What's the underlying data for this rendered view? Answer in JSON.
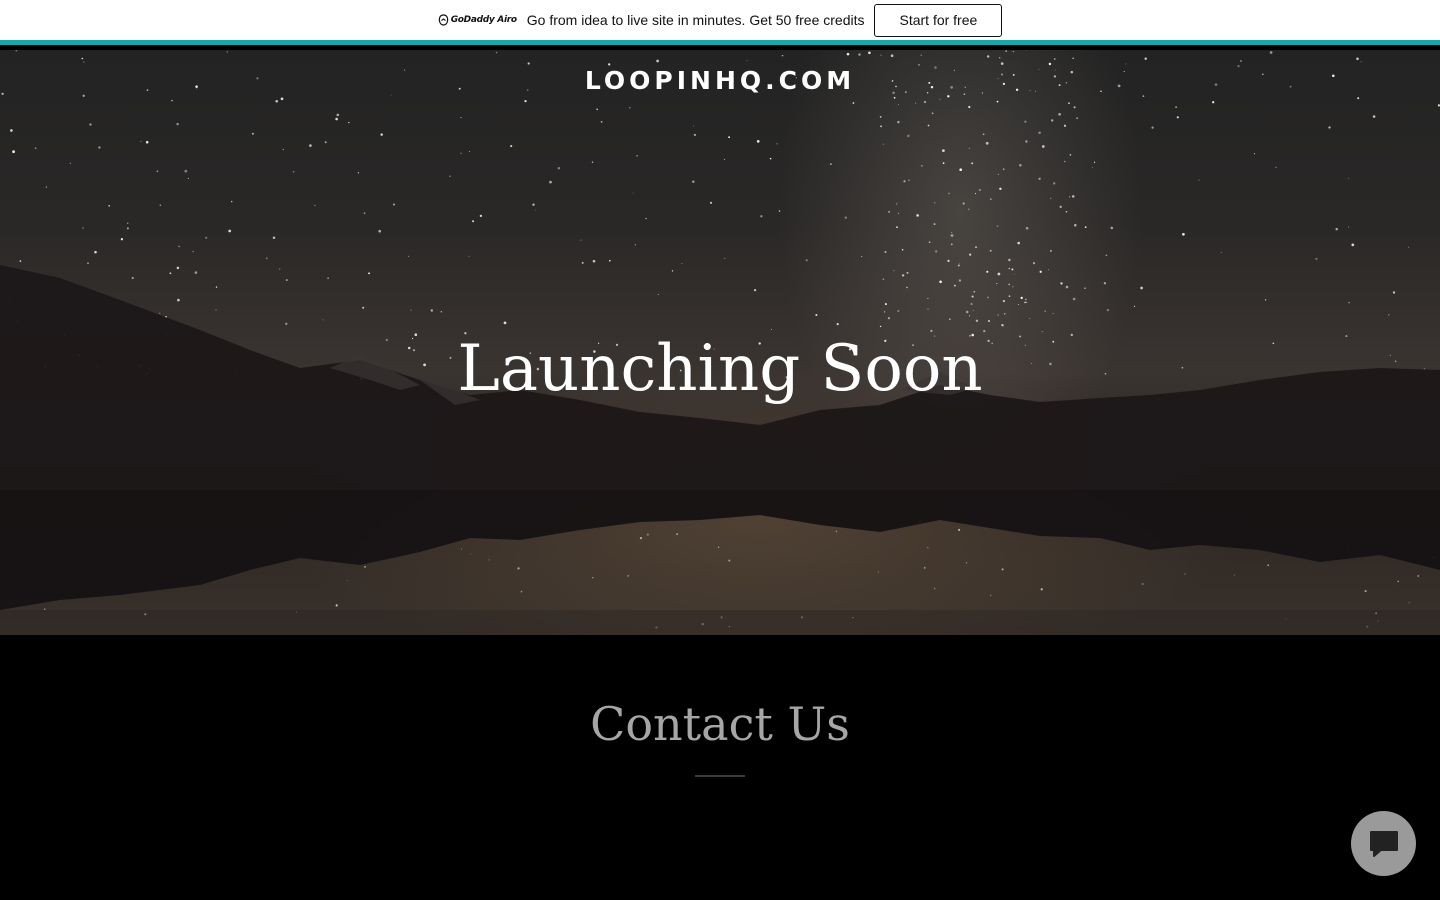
{
  "promo": {
    "brand": "GoDaddy Airo",
    "message": "Go from idea to live site in minutes. Get 50 free credits",
    "cta_label": "Start for free",
    "accent_color": "#1ba6a6"
  },
  "hero": {
    "site_title": "LOOPINHQ.COM",
    "heading": "Launching Soon",
    "background": "starry-night-mountain-lake"
  },
  "contact": {
    "heading": "Contact Us"
  },
  "chat": {
    "icon": "chat-bubble-icon",
    "color": "#9a9a9a"
  }
}
